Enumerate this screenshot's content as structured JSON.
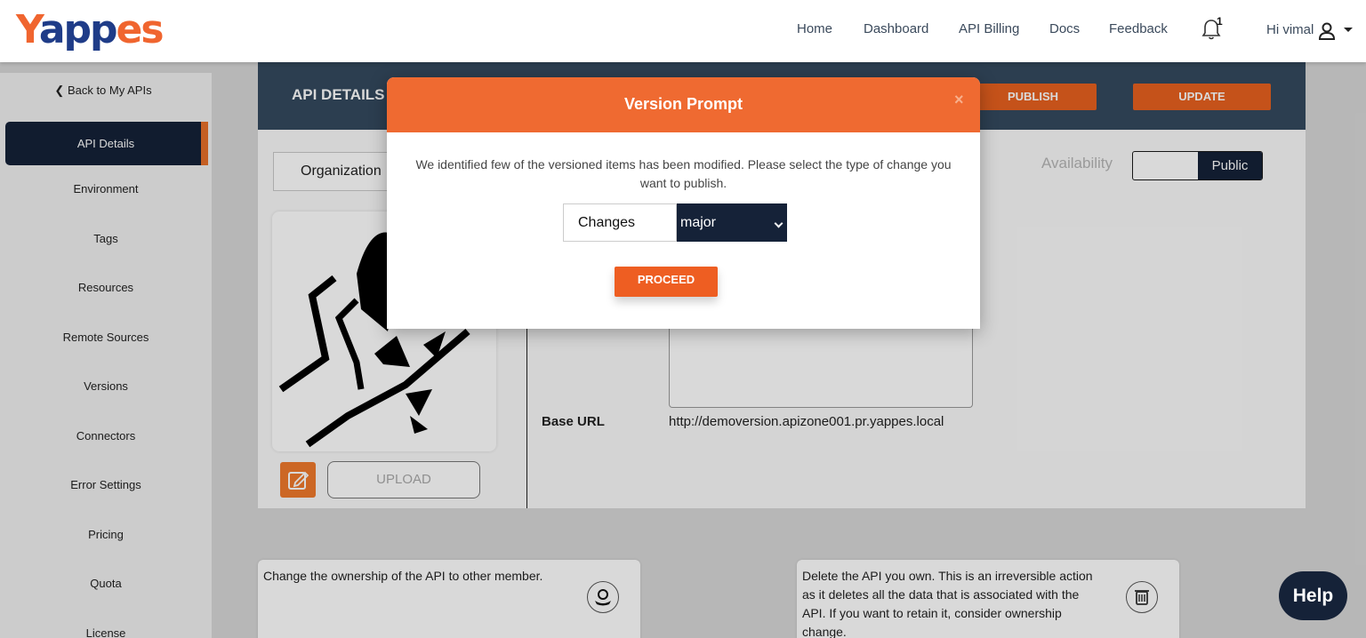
{
  "header": {
    "logo": "Yappes",
    "nav": [
      "Home",
      "Dashboard",
      "API Billing",
      "Docs",
      "Feedback"
    ],
    "notification_count": "1",
    "greeting": "Hi vimal"
  },
  "sidebar": {
    "back_label": "Back to My APIs",
    "items": [
      {
        "label": "API Details"
      },
      {
        "label": "Environment"
      },
      {
        "label": "Tags"
      },
      {
        "label": "Resources"
      },
      {
        "label": "Remote Sources"
      },
      {
        "label": "Versions"
      },
      {
        "label": "Connectors"
      },
      {
        "label": "Error Settings"
      },
      {
        "label": "Pricing"
      },
      {
        "label": "Quota"
      },
      {
        "label": "License"
      }
    ]
  },
  "main": {
    "title": "API DETAILS",
    "publish_label": "PUBLISH",
    "update_label": "UPDATE",
    "org_value": "Organization",
    "upload_label": "UPLOAD",
    "base_url_label": "Base URL",
    "base_url_value": "http://demoversion.apizone001.pr.yappes.local",
    "availability_label": "Availability",
    "availability_value": "Public",
    "ownership_text": "Change the ownership of the API to other member.",
    "delete_text_lines": [
      "Delete the API you own. This is an irreversible action",
      "as it deletes all the data that is associated with the",
      "API. If you want to retain it, consider ownership",
      "change."
    ],
    "help_label": "Help"
  },
  "modal": {
    "title": "Version Prompt",
    "close": "×",
    "message": "We identified few of the versioned items has been modified. Please select the type of change you want to publish.",
    "changes_label": "Changes",
    "change_type_value": "major",
    "proceed_label": "PROCEED"
  },
  "colors": {
    "orange": "#ef6a31",
    "navy": "#152238",
    "slate": "#34495e"
  }
}
